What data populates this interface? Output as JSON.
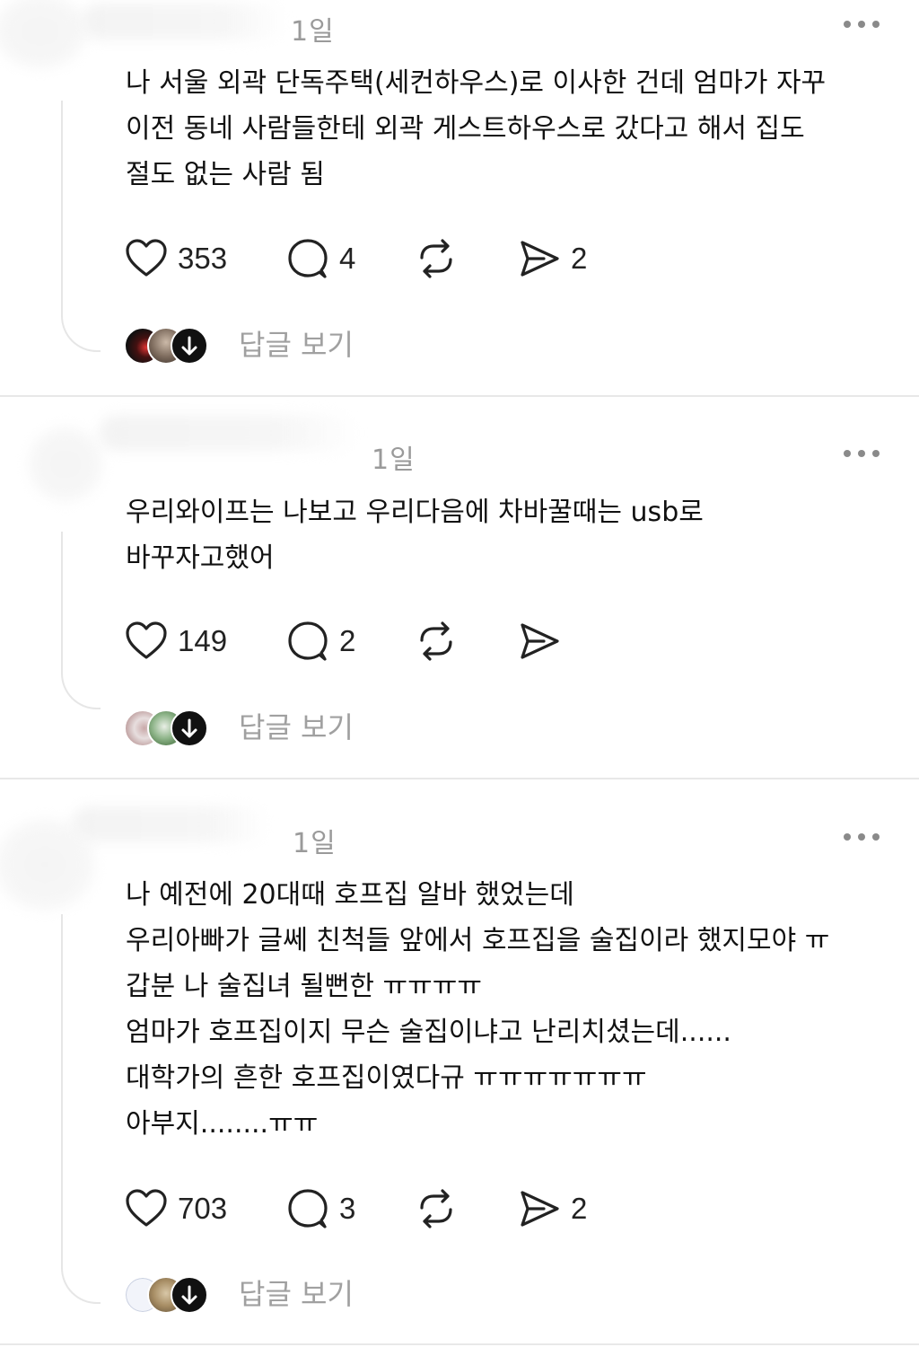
{
  "posts": [
    {
      "timestamp": "1일",
      "lines": [
        "나 서울 외곽 단독주택(세컨하우스)로 이사한 건데 엄마가 자꾸",
        "이전 동네 사람들한테 외곽 게스트하우스로 갔다고 해서 집도",
        "절도 없는 사람 됨"
      ],
      "likes": "353",
      "comments": "4",
      "shares": "2",
      "view_replies": "답글 보기"
    },
    {
      "timestamp": "1일",
      "lines": [
        "우리와이프는 나보고 우리다음에 차바꿀때는 usb로",
        "바꾸자고했어"
      ],
      "likes": "149",
      "comments": "2",
      "shares": "",
      "view_replies": "답글 보기"
    },
    {
      "timestamp": "1일",
      "lines": [
        "나 예전에 20대때 호프집 알바 했었는데",
        "우리아빠가 글쎄 친척들 앞에서 호프집을 술집이라 했지모야 ㅠ",
        "갑분 나 술집녀 될뻔한 ㅠㅠㅠㅠ",
        "엄마가 호프집이지 무슨 술집이냐고 난리치셨는데......",
        "대학가의 흔한 호프집이였다규 ㅠㅠㅠㅠㅠㅠㅠ",
        "아부지........ㅠㅠ"
      ],
      "likes": "703",
      "comments": "3",
      "shares": "2",
      "view_replies": "답글 보기"
    }
  ],
  "icons": {
    "like": "heart-icon",
    "comment": "speech-bubble-icon",
    "repost": "repost-icon",
    "share": "send-icon",
    "more": "more-dots-icon",
    "expand": "arrow-down-icon"
  },
  "colors": {
    "text": "#111111",
    "muted": "#9a9a9a",
    "divider": "#e8e8e8",
    "icon": "#222222"
  }
}
